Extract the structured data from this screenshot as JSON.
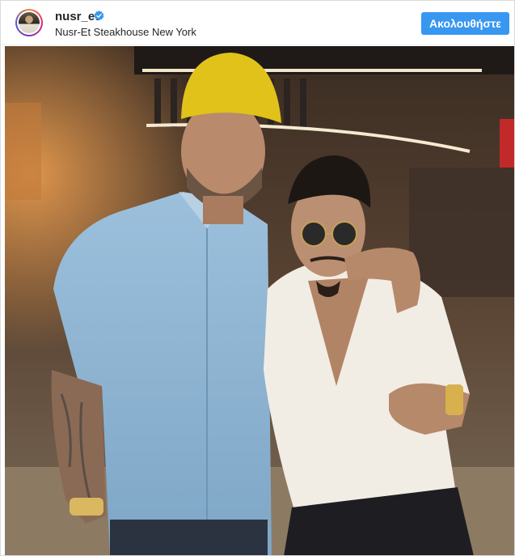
{
  "post": {
    "username": "nusr_et",
    "location": "Nusr-Et Steakhouse New York",
    "follow_label": "Ακολουθήστε",
    "colors": {
      "accent": "#3897f0",
      "verified": "#3897f0",
      "text": "#262626",
      "border": "#dbdbdb"
    },
    "icons": {
      "verified": "verified-badge-icon"
    }
  }
}
